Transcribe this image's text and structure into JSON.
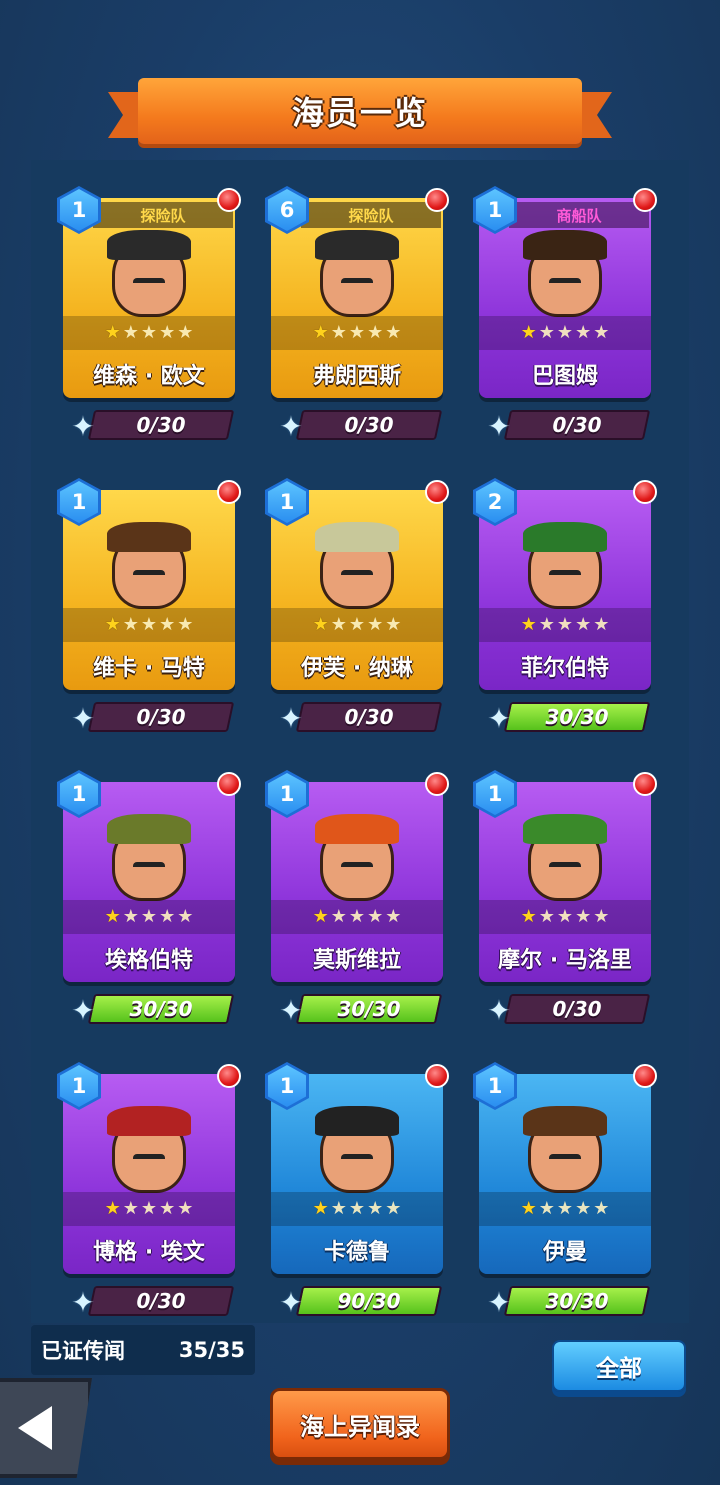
{
  "title": "海员一览",
  "cards": [
    {
      "name": "维森 · 欧文",
      "level": "1",
      "team": "探险队",
      "team_style": "gold",
      "theme": "gold",
      "stars": 1,
      "shards": "0/30",
      "progress": 0,
      "hat": "#2a2a2a"
    },
    {
      "name": "弗朗西斯",
      "level": "6",
      "team": "探险队",
      "team_style": "gold",
      "theme": "gold",
      "stars": 1,
      "shards": "0/30",
      "progress": 0,
      "hat": "#2a2a2a"
    },
    {
      "name": "巴图姆",
      "level": "1",
      "team": "商船队",
      "team_style": "magenta",
      "theme": "purple",
      "stars": 1,
      "shards": "0/30",
      "progress": 0,
      "hat": "#3a2414"
    },
    {
      "name": "维卡 · 马特",
      "level": "1",
      "team": "",
      "team_style": "",
      "theme": "gold",
      "stars": 1,
      "shards": "0/30",
      "progress": 0,
      "hat": "#5a3418"
    },
    {
      "name": "伊芙 · 纳琳",
      "level": "1",
      "team": "",
      "team_style": "",
      "theme": "gold",
      "stars": 1,
      "shards": "0/30",
      "progress": 0,
      "hat": "#c8c89a"
    },
    {
      "name": "菲尔伯特",
      "level": "2",
      "team": "",
      "team_style": "",
      "theme": "purple",
      "stars": 1,
      "shards": "30/30",
      "progress": 1,
      "hat": "#2a7a2a"
    },
    {
      "name": "埃格伯特",
      "level": "1",
      "team": "",
      "team_style": "",
      "theme": "purple",
      "stars": 1,
      "shards": "30/30",
      "progress": 1,
      "hat": "#6a7a2a"
    },
    {
      "name": "莫斯维拉",
      "level": "1",
      "team": "",
      "team_style": "",
      "theme": "purple",
      "stars": 1,
      "shards": "30/30",
      "progress": 1,
      "hat": "#e0561a"
    },
    {
      "name": "摩尔 · 马洛里",
      "level": "1",
      "team": "",
      "team_style": "",
      "theme": "purple",
      "stars": 1,
      "shards": "0/30",
      "progress": 0,
      "hat": "#3a8a2a"
    },
    {
      "name": "博格 · 埃文",
      "level": "1",
      "team": "",
      "team_style": "",
      "theme": "purple",
      "stars": 1,
      "shards": "0/30",
      "progress": 0,
      "hat": "#b22222"
    },
    {
      "name": "卡德鲁",
      "level": "1",
      "team": "",
      "team_style": "",
      "theme": "blue",
      "stars": 1,
      "shards": "90/30",
      "progress": 1,
      "hat": "#222222"
    },
    {
      "name": "伊曼",
      "level": "1",
      "team": "",
      "team_style": "",
      "theme": "blue",
      "stars": 1,
      "shards": "30/30",
      "progress": 1,
      "hat": "#5a3418"
    }
  ],
  "verified_label": "已证传闻",
  "verified_count": "35/35",
  "all_button": "全部",
  "log_button": "海上异闻录"
}
